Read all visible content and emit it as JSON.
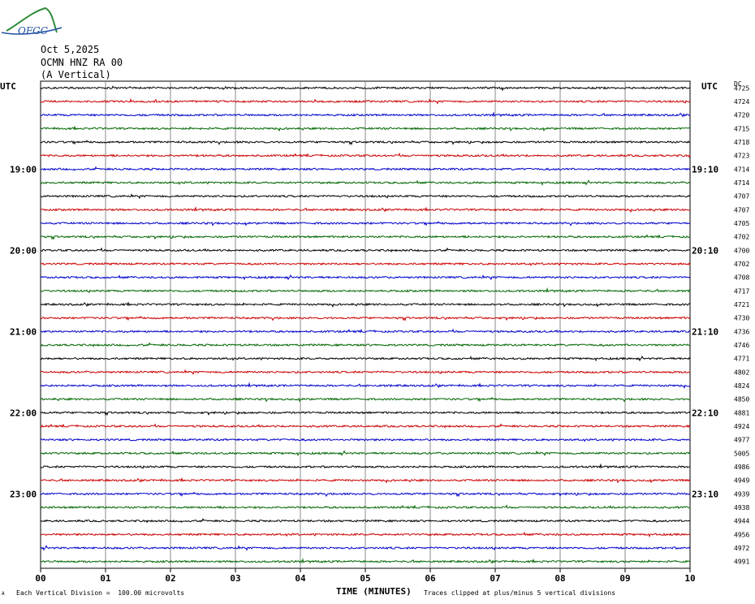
{
  "logo_text": "OFGC",
  "header": {
    "date": "Oct 5,2025",
    "station": "OCMN HNZ RA 00",
    "component": "(A Vertical)"
  },
  "left_label": "UTC",
  "right_label": "UTC",
  "dc_label": "DC",
  "footer": {
    "mark": "A",
    "scale": "Each Vertical Division =  100.00 microvolts",
    "xlabel": "TIME (MINUTES)",
    "clip_note": "Traces clipped at plus/minus 5 vertical divisions"
  },
  "chart_data": {
    "type": "line",
    "title": "Oct 5,2025 OCMN HNZ RA 00 (A Vertical)",
    "xlabel": "TIME (MINUTES)",
    "x_ticks": [
      "00",
      "01",
      "02",
      "03",
      "04",
      "05",
      "06",
      "07",
      "08",
      "09",
      "10"
    ],
    "xlim": [
      0,
      10
    ],
    "trace_count": 36,
    "trace_minutes": 10,
    "trace_colors": [
      "#000000",
      "#cc0000",
      "#0000cc",
      "#006600"
    ],
    "left_time_labels": [
      {
        "trace": 6,
        "label": "19:00"
      },
      {
        "trace": 12,
        "label": "20:00"
      },
      {
        "trace": 18,
        "label": "21:00"
      },
      {
        "trace": 24,
        "label": "22:00"
      },
      {
        "trace": 30,
        "label": "23:00"
      }
    ],
    "right_time_labels": [
      {
        "trace": 6,
        "label": "19:10"
      },
      {
        "trace": 12,
        "label": "20:10"
      },
      {
        "trace": 18,
        "label": "21:10"
      },
      {
        "trace": 24,
        "label": "22:10"
      },
      {
        "trace": 30,
        "label": "23:10"
      }
    ],
    "dc_offsets": [
      4725,
      4724,
      4720,
      4715,
      4718,
      4723,
      4714,
      4714,
      4707,
      4707,
      4705,
      4702,
      4700,
      4702,
      4708,
      4717,
      4721,
      4730,
      4736,
      4746,
      4771,
      4802,
      4824,
      4850,
      4881,
      4924,
      4977,
      5005,
      4986,
      4949,
      4939,
      4938,
      4944,
      4956,
      4972,
      4991
    ],
    "grid": true
  }
}
